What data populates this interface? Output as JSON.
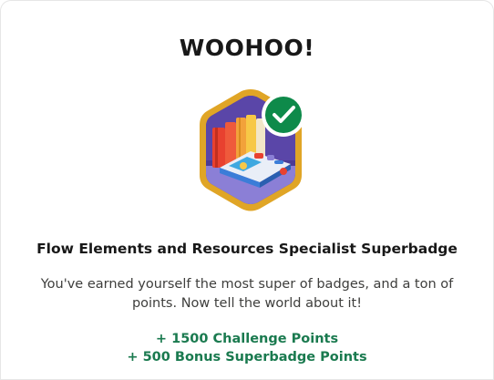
{
  "dialog": {
    "title": "WOOHOO!",
    "badge_icon": "books-superbadge-icon",
    "check_icon": "checkmark-icon",
    "badge_name": "Flow Elements and Resources Specialist Superbadge",
    "message": "You've earned yourself the most super of badges, and a ton of points. Now tell the world about it!",
    "challenge_points": "+ 1500 Challenge Points",
    "bonus_points": "+ 500 Bonus Superbadge Points"
  },
  "colors": {
    "points_green": "#1a7a4f",
    "badge_border": "#e0a526",
    "badge_fill": "#6a4fb3",
    "check_green": "#0e8a4a"
  }
}
